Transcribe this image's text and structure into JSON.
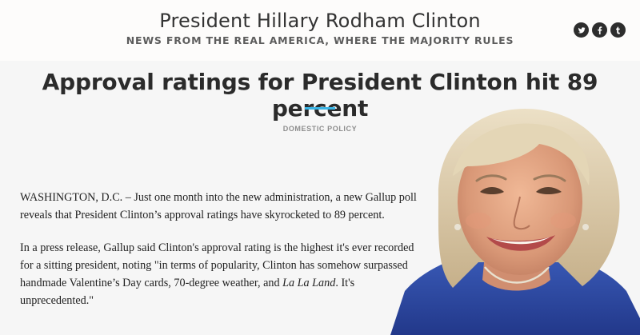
{
  "site": {
    "title": "President Hillary Rodham Clinton",
    "tagline": "NEWS FROM THE REAL AMERICA, WHERE THE MAJORITY RULES"
  },
  "social": [
    {
      "name": "twitter-icon",
      "label": "twitter"
    },
    {
      "name": "facebook-icon",
      "label": "facebook"
    },
    {
      "name": "tumblr-icon",
      "label": "tumblr"
    }
  ],
  "article": {
    "headline": "Approval ratings for President Clinton hit 89 percent",
    "category": "DOMESTIC POLICY",
    "p1": "WASHINGTON, D.C. – Just one month into the new administration, a new Gallup poll reveals that President Clinton’s approval ratings have skyrocketed to 89 percent.",
    "p2_before": "In a press release, Gallup said Clinton's approval rating is the highest it's ever recorded for a sitting president, noting \"in terms of popularity, Clinton has somehow surpassed handmade Valentine’s Day cards, 70-degree weather, and ",
    "p2_italic": "La La Land",
    "p2_after": ". It's unprecedented.\""
  },
  "colors": {
    "accent": "#3ab5e6",
    "header_bg": "#fdfcfb",
    "page_bg": "#f6f6f6",
    "jacket": "#2f4fa8"
  }
}
